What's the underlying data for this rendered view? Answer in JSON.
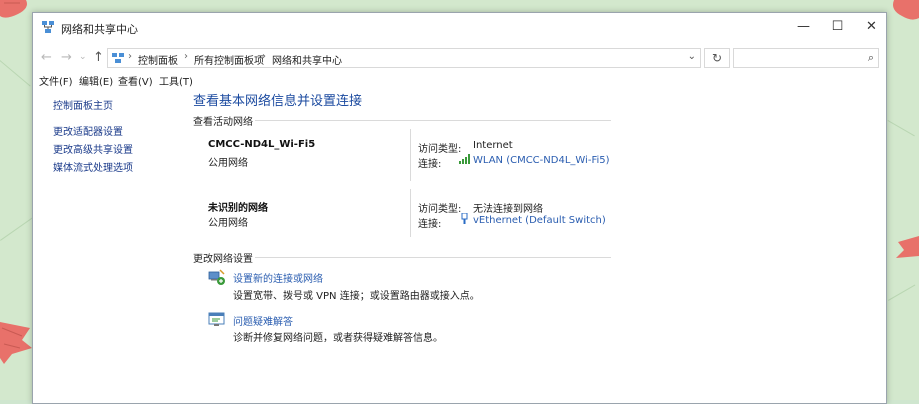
{
  "window": {
    "title": "网络和共享中心",
    "minimize_glyph": "—",
    "maximize_glyph": "☐",
    "close_glyph": "✕"
  },
  "address_bar": {
    "breadcrumbs": [
      "控制面板",
      "所有控制面板项",
      "网络和共享中心"
    ],
    "separator": "›",
    "refresh_icon": "refresh-icon",
    "search_placeholder": ""
  },
  "menu": [
    "文件(F)",
    "编辑(E)",
    "查看(V)",
    "工具(T)"
  ],
  "sidebar": {
    "home": "控制面板主页",
    "links": [
      "更改适配器设置",
      "更改高级共享设置",
      "媒体流式处理选项"
    ]
  },
  "main": {
    "title": "查看基本网络信息并设置连接",
    "active_networks_header": "查看活动网络",
    "networks": [
      {
        "name": "CMCC-ND4L_Wi-Fi5",
        "type": "公用网络",
        "access_label": "访问类型:",
        "access_value": "Internet",
        "conn_label": "连接:",
        "conn_value": "WLAN (CMCC-ND4L_Wi-Fi5)",
        "conn_icon": "wifi-signal-icon"
      },
      {
        "name": "未识别的网络",
        "type": "公用网络",
        "access_label": "访问类型:",
        "access_value": "无法连接到网络",
        "conn_label": "连接:",
        "conn_value": "vEthernet (Default Switch)",
        "conn_icon": "ethernet-icon"
      }
    ],
    "change_settings_header": "更改网络设置",
    "tasks": [
      {
        "link": "设置新的连接或网络",
        "desc": "设置宽带、拨号或 VPN 连接；或设置路由器或接入点。",
        "icon": "new-connection-icon"
      },
      {
        "link": "问题疑难解答",
        "desc": "诊断并修复网络问题，或者获得疑难解答信息。",
        "icon": "troubleshoot-icon"
      }
    ]
  },
  "colors": {
    "link": "#2a5db0",
    "title": "#1c4ba0",
    "desktop": "#d3e8cd"
  }
}
